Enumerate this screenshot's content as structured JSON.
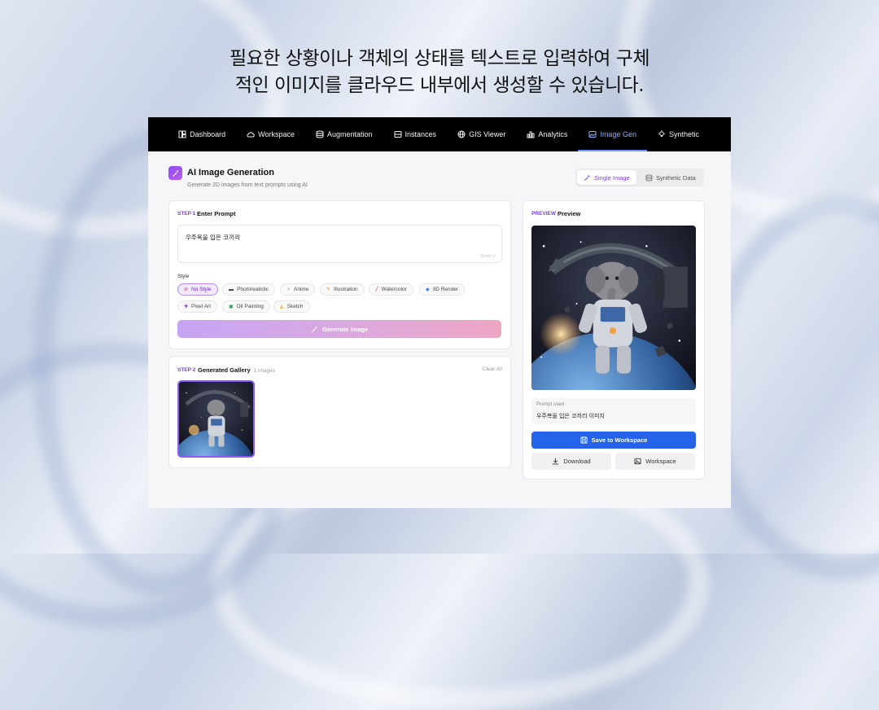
{
  "headline": {
    "line1": "필요한 상황이나 객체의 상태를 텍스트로 입력하여 구체",
    "line2": "적인 이미지를 클라우드 내부에서 생성할 수 있습니다."
  },
  "nav": {
    "items": [
      {
        "label": "Dashboard",
        "icon": "dashboard-icon"
      },
      {
        "label": "Workspace",
        "icon": "cloud-icon"
      },
      {
        "label": "Augmentation",
        "icon": "database-icon"
      },
      {
        "label": "Instances",
        "icon": "server-icon"
      },
      {
        "label": "GIS Viewer",
        "icon": "globe-icon"
      },
      {
        "label": "Analytics",
        "icon": "bar-chart-icon"
      },
      {
        "label": "Image Gen",
        "icon": "image-icon",
        "active": true
      },
      {
        "label": "Synthetic",
        "icon": "lightbulb-icon"
      }
    ]
  },
  "page": {
    "title": "AI Image Generation",
    "subtitle": "Generate 2D images from text prompts using AI",
    "mode_single": "Single Image",
    "mode_synthetic": "Synthetic Data"
  },
  "step1": {
    "step": "STEP 1",
    "title": "Enter Prompt",
    "prompt_value": "우주복을 입은 코끼리",
    "prompt_hint": "Enter ↵",
    "style_label": "Style",
    "styles": [
      {
        "label": "No Style",
        "selected": true
      },
      {
        "label": "Photorealistic"
      },
      {
        "label": "Anime"
      },
      {
        "label": "Illustration"
      },
      {
        "label": "Watercolor"
      },
      {
        "label": "3D Render"
      },
      {
        "label": "Pixel Art"
      },
      {
        "label": "Oil Painting"
      },
      {
        "label": "Sketch"
      }
    ],
    "generate_label": "Generate Image"
  },
  "step2": {
    "step": "STEP 2",
    "title": "Generated Gallery",
    "count": "1 images",
    "clear": "Clear All"
  },
  "preview": {
    "tag": "PREVIEW",
    "title": "Preview",
    "prompt_used_label": "Prompt used",
    "prompt_used_value": "우주복을 입은 코끼리 이미지",
    "save_label": "Save to Workspace",
    "download_label": "Download",
    "workspace_label": "Workspace"
  },
  "colors": {
    "accent": "#7c3aed",
    "primary_button": "#2563eb",
    "nav_active": "#8db0ff"
  }
}
